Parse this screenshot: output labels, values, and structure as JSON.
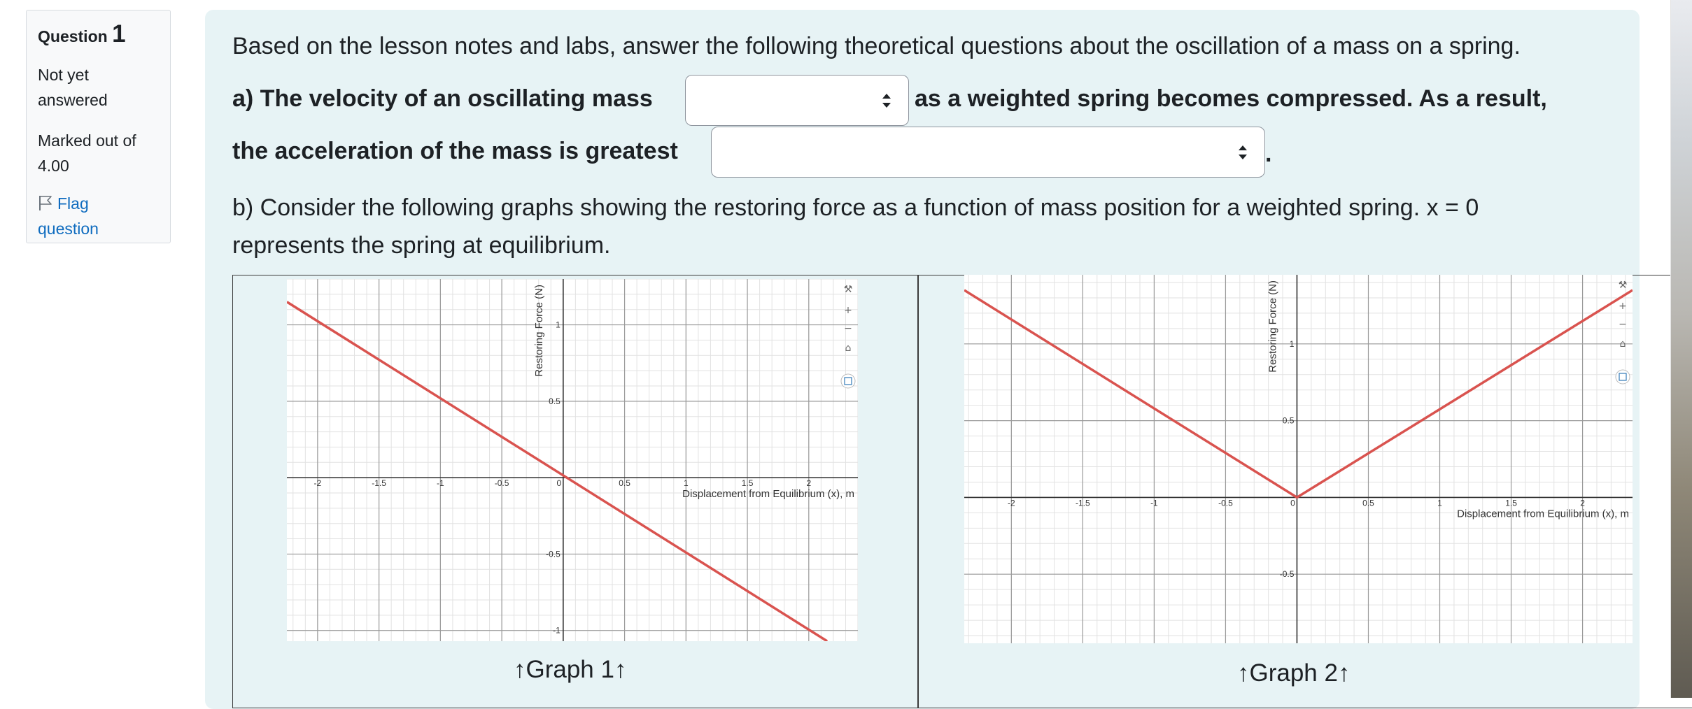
{
  "question_info": {
    "label": "Question",
    "number": "1",
    "state_line1": "Not yet",
    "state_line2": "answered",
    "grade_line1": "Marked out of",
    "grade_line2": "4.00",
    "flag_line1": "Flag",
    "flag_line2": "question",
    "flag_icon": "flag-icon"
  },
  "question": {
    "intro": "Based on the lesson notes and labs, answer the following theoretical questions about the oscillation of a mass on a spring.",
    "part_a_1": "a)  The velocity of an oscillating mass",
    "part_a_2": "as a weighted spring becomes compressed.  As a result,",
    "part_a_3": "the acceleration of the mass is greatest",
    "part_a_end": ".",
    "select1_value": "",
    "select2_value": "",
    "part_b_1": "b)  Consider the following graphs showing the restoring force as a function of mass position for a weighted spring.  x = 0",
    "part_b_2": "represents the spring at equilibrium."
  },
  "graphs": {
    "caption1": "↑Graph 1↑",
    "caption2": "↑Graph 2↑",
    "toolbar_icons": [
      "wrench-icon",
      "zoom-in-icon",
      "zoom-out-icon",
      "home-icon",
      "fullscreen-icon"
    ],
    "toolbar_symbols": {
      "plus": "+",
      "minus": "−",
      "home": "⌂",
      "wrench": "⚒"
    }
  },
  "chart_data": [
    {
      "type": "line",
      "title": "",
      "xlabel": "Displacement from Equilibrium (x), m",
      "ylabel": "Restoring Force (N)",
      "x_ticks": [
        "-2",
        "-1.5",
        "-1",
        "-0.5",
        "0",
        "0.5",
        "1",
        "1.5",
        "2"
      ],
      "y_ticks": [
        "1",
        "0.5",
        "-0.5",
        "-1"
      ],
      "xlim": [
        -2.25,
        2.4
      ],
      "ylim": [
        -1.07,
        1.3
      ],
      "color": "#d9534f",
      "series": [
        {
          "x": [
            -2.25,
            2.15
          ],
          "y": [
            1.15,
            -1.07
          ]
        }
      ]
    },
    {
      "type": "line",
      "title": "",
      "xlabel": "Displacement from Equilibrium (x), m",
      "ylabel": "Restoring Force (N)",
      "x_ticks": [
        "-2",
        "-1.5",
        "-1",
        "-0.5",
        "0",
        "0.5",
        "1",
        "1.5",
        "2"
      ],
      "y_ticks": [
        "1",
        "0.5",
        "-0.5"
      ],
      "xlim": [
        -2.33,
        2.35
      ],
      "ylim": [
        -0.95,
        1.45
      ],
      "color": "#d9534f",
      "series": [
        {
          "x": [
            -2.33,
            0,
            2.35
          ],
          "y": [
            1.35,
            0,
            1.35
          ]
        }
      ]
    }
  ]
}
